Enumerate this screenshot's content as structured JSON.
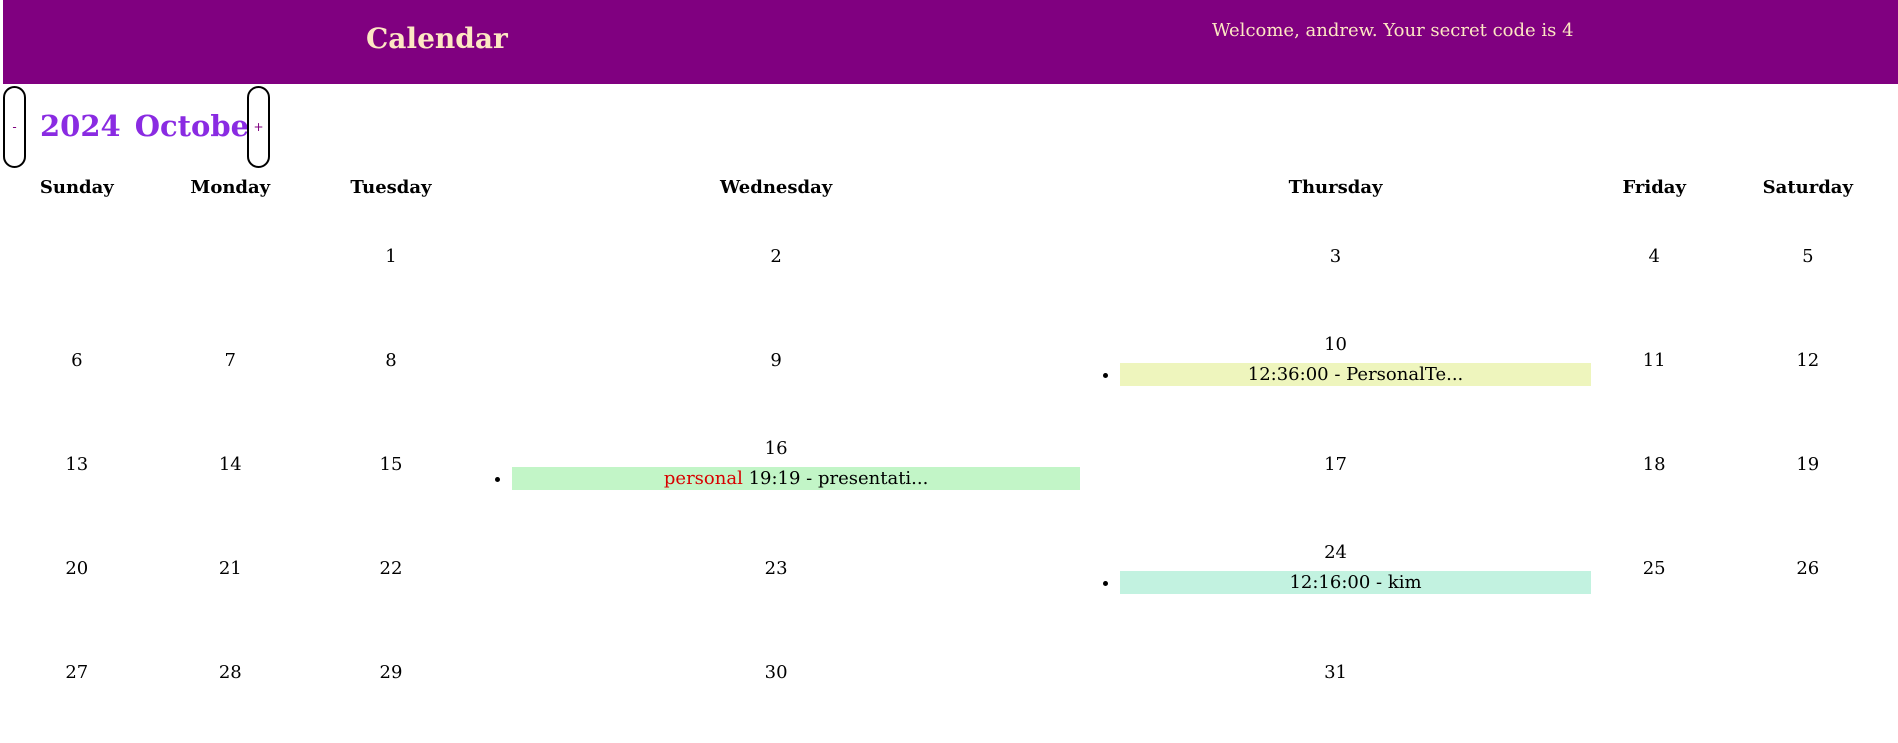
{
  "header": {
    "title": "Calendar",
    "welcome": "Welcome, andrew. Your secret code is 4",
    "background": "#800080",
    "text_color": "#fde7c3"
  },
  "nav": {
    "prev_label": "-",
    "next_label": "+",
    "year": "2024",
    "month": "October",
    "month_color": "#8a2be2"
  },
  "weekdays": [
    "Sunday",
    "Monday",
    "Tuesday",
    "Wednesday",
    "Thursday",
    "Friday",
    "Saturday"
  ],
  "weeks": [
    [
      {
        "day": ""
      },
      {
        "day": ""
      },
      {
        "day": "1"
      },
      {
        "day": "2"
      },
      {
        "day": "3"
      },
      {
        "day": "4"
      },
      {
        "day": "5"
      }
    ],
    [
      {
        "day": "6"
      },
      {
        "day": "7"
      },
      {
        "day": "8"
      },
      {
        "day": "9"
      },
      {
        "day": "10",
        "events": [
          {
            "tag": "",
            "text": "12:36:00 - PersonalTe...",
            "color": "#eef5bd"
          }
        ]
      },
      {
        "day": "11"
      },
      {
        "day": "12"
      }
    ],
    [
      {
        "day": "13"
      },
      {
        "day": "14"
      },
      {
        "day": "15"
      },
      {
        "day": "16",
        "events": [
          {
            "tag": "personal",
            "text": " 19:19 - presentati...",
            "color": "#c2f5c7"
          }
        ]
      },
      {
        "day": "17"
      },
      {
        "day": "18"
      },
      {
        "day": "19"
      }
    ],
    [
      {
        "day": "20"
      },
      {
        "day": "21"
      },
      {
        "day": "22"
      },
      {
        "day": "23"
      },
      {
        "day": "24",
        "events": [
          {
            "tag": "",
            "text": "12:16:00 - kim",
            "color": "#c2f2e0"
          }
        ]
      },
      {
        "day": "25"
      },
      {
        "day": "26"
      }
    ],
    [
      {
        "day": "27"
      },
      {
        "day": "28"
      },
      {
        "day": "29"
      },
      {
        "day": "30"
      },
      {
        "day": "31"
      },
      {
        "day": ""
      },
      {
        "day": ""
      }
    ]
  ]
}
